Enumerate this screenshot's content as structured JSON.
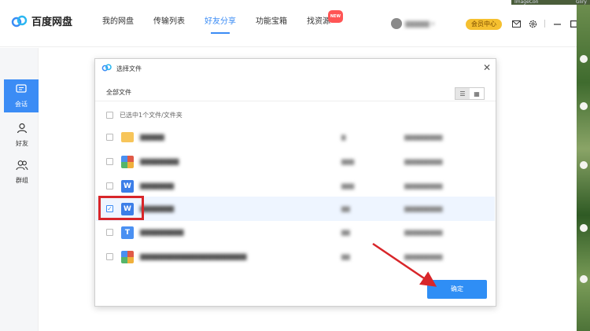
{
  "app": {
    "logo_text": "百度网盘",
    "nav": [
      {
        "label": "我的网盘"
      },
      {
        "label": "传输列表"
      },
      {
        "label": "好友分享"
      },
      {
        "label": "功能宝箱"
      },
      {
        "label": "找资源",
        "badge": "NEW"
      }
    ],
    "active_nav_index": 2,
    "vip_label": "会员中心",
    "colors": {
      "accent": "#3b8cf5",
      "vip": "#f5c030",
      "highlight": "#d8262a",
      "arrow": "#d8262a"
    }
  },
  "desktop": {
    "labels": [
      "ImageCon",
      "Gliry"
    ]
  },
  "sidebar": {
    "items": [
      {
        "label": "会话",
        "icon": "chat-icon",
        "active": true
      },
      {
        "label": "好友",
        "icon": "friend-icon",
        "active": false
      },
      {
        "label": "群组",
        "icon": "group-icon",
        "active": false
      }
    ]
  },
  "dialog": {
    "title": "选择文件",
    "breadcrumb": "全部文件",
    "selection_info": "已选中1个文件/文件夹",
    "confirm_label": "确定",
    "files": [
      {
        "type": "folder",
        "icon_char": "",
        "checked": false
      },
      {
        "type": "mixed",
        "icon_char": "",
        "checked": false
      },
      {
        "type": "word",
        "icon_char": "W",
        "checked": false
      },
      {
        "type": "word",
        "icon_char": "W",
        "checked": true
      },
      {
        "type": "txt",
        "icon_char": "T",
        "checked": false
      },
      {
        "type": "mixed",
        "icon_char": "",
        "checked": false
      }
    ]
  }
}
